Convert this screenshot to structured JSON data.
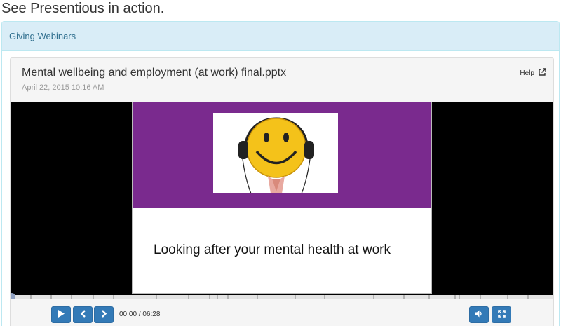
{
  "page": {
    "title": "See Presentious in action."
  },
  "panel": {
    "heading": "Giving Webinars"
  },
  "viewer": {
    "title": "Mental wellbeing and employment (at work) final.pptx",
    "date": "April 22, 2015 10:16 AM",
    "help_label": "Help"
  },
  "slide": {
    "text": "Looking after your mental health at work",
    "banner_color": "#7a2a8e"
  },
  "player": {
    "current_time": "00:00",
    "duration": "06:28",
    "progress": 0
  },
  "icons": {
    "help": "external-link-icon",
    "play": "play-icon",
    "prev": "chevron-left-icon",
    "next": "chevron-right-icon",
    "volume": "volume-icon",
    "fullscreen": "fullscreen-icon",
    "slide_image": "smiley-headphones-image"
  },
  "colors": {
    "accent": "#337ab7",
    "panel_heading_bg": "#d9edf7",
    "panel_heading_text": "#31708f"
  }
}
